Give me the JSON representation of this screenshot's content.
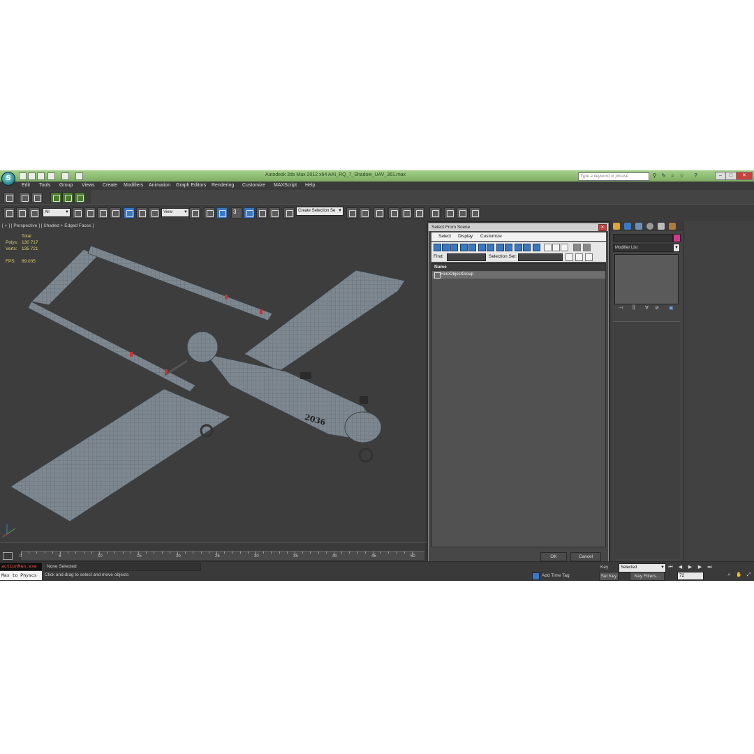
{
  "app": {
    "title": "Autodesk 3ds Max 2012 x64     AAI_RQ_7_Shadow_UAV_361.max",
    "search_placeholder": "Type a keyword or phrase",
    "logo_glyph": "S"
  },
  "menu": [
    "Edit",
    "Tools",
    "Group",
    "Views",
    "Create",
    "Modifiers",
    "Animation",
    "Graph Editors",
    "Rendering",
    "Customize",
    "MAXScript",
    "Help"
  ],
  "toolbar": {
    "filter_dropdown": "All",
    "coord_dropdown": "View",
    "selection_set_dropdown": "Create Selection Se",
    "snap_label": "3"
  },
  "viewport": {
    "label": "[ + ] [ Perspective ] [ Shaded + Edged Faces ]",
    "stats_header": "Total",
    "polys_label": "Polys:",
    "polys_value": "130 717",
    "verts_label": "Verts:",
    "verts_value": "135 721",
    "fps_label": "FPS:",
    "fps_value": "89.035",
    "tail_number": "2036"
  },
  "timeline": {
    "ticks": [
      "0",
      "5",
      "10",
      "15",
      "20",
      "25",
      "30",
      "35",
      "40",
      "45",
      "50"
    ]
  },
  "dialog": {
    "title": "Select From Scene",
    "menu": [
      "Select",
      "Display",
      "Customize"
    ],
    "find_label": "Find:",
    "selection_set_label": "Selection Set:",
    "name_column": "Name",
    "rows": [
      "HeroObjectGroup"
    ],
    "ok": "OK",
    "cancel": "Cancel"
  },
  "command_panel": {
    "modifier_list": "Modifier List",
    "object_color": "#d03a8e"
  },
  "status": {
    "script_listener": "actionMan.exe",
    "script_input": "Max to Physcs",
    "selection": "None Selected",
    "prompt": "Click and drag to select and move objects",
    "add_time_tag": "Add Time Tag",
    "auto_key": "Key",
    "selected_dropdown": "Selected",
    "set_key": "Set Key",
    "key_filters": "Key Filters...",
    "frame": "72"
  }
}
